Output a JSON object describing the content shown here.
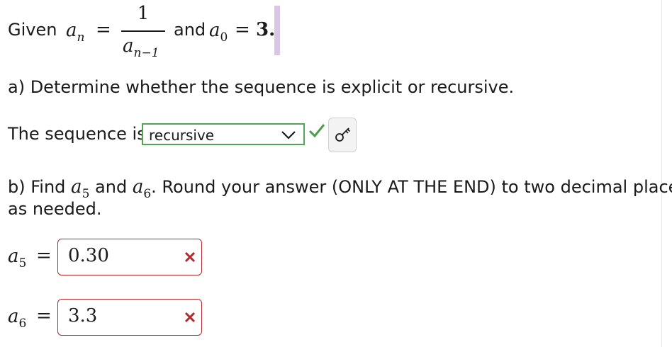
{
  "given": {
    "prefix": "Given",
    "lhs_var": "a",
    "lhs_sub": "n",
    "equals": "=",
    "numerator": "1",
    "denominator_var": "a",
    "denominator_sub": "n−1",
    "conjunction": "and",
    "init_var": "a",
    "init_sub": "0",
    "init_equals": "=",
    "init_value": "3."
  },
  "part_a": {
    "question": "a) Determine whether the sequence is explicit or recursive.",
    "label": "The sequence is",
    "selected": "recursive",
    "status": "correct"
  },
  "part_b": {
    "q_prefix": "b) Find",
    "a5_var": "a",
    "a5_sub": "5",
    "q_and": "and",
    "a6_var": "a",
    "a6_sub": "6",
    "q_suffix": ". Round your answer (ONLY AT THE END) to two decimal places",
    "q_line2": "as needed.",
    "answers": [
      {
        "var": "a",
        "sub": "5",
        "equals": "=",
        "value": "0.30",
        "status": "incorrect"
      },
      {
        "var": "a",
        "sub": "6",
        "equals": "=",
        "value": "3.3",
        "status": "incorrect"
      }
    ]
  },
  "colors": {
    "correct": "#4a9e4a",
    "incorrect": "#b02a2a",
    "highlight": "#d9c6e6"
  },
  "icons": [
    "chevron-down-icon",
    "check-icon",
    "key-icon",
    "close-icon"
  ]
}
